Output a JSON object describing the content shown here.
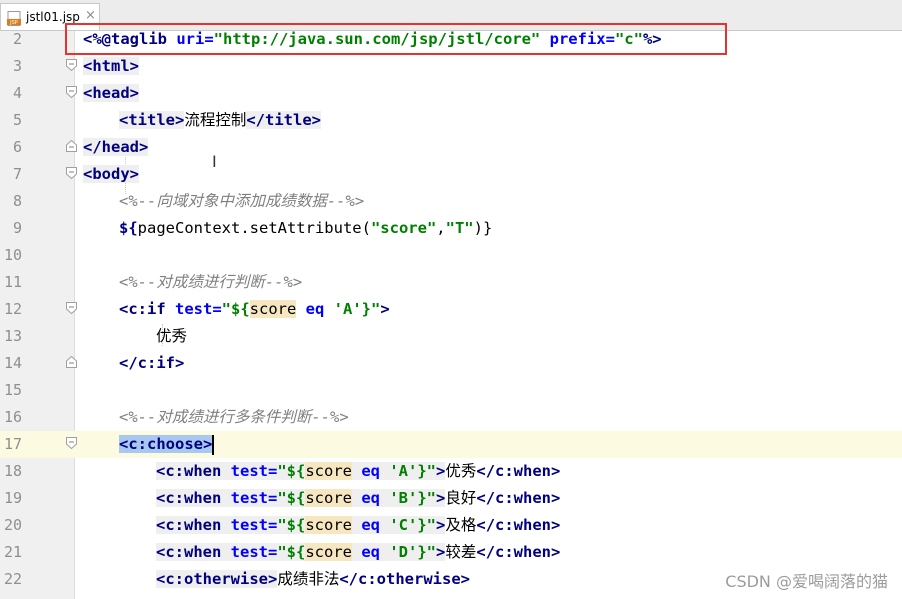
{
  "tab": {
    "filename": "jstl01.jsp",
    "icon_label": "JSP",
    "close": "×"
  },
  "lines": [
    {
      "n": "2"
    },
    {
      "n": "3"
    },
    {
      "n": "4"
    },
    {
      "n": "5"
    },
    {
      "n": "6"
    },
    {
      "n": "7"
    },
    {
      "n": "8"
    },
    {
      "n": "9"
    },
    {
      "n": "10"
    },
    {
      "n": "11"
    },
    {
      "n": "12"
    },
    {
      "n": "13"
    },
    {
      "n": "14"
    },
    {
      "n": "15"
    },
    {
      "n": "16"
    },
    {
      "n": "17"
    },
    {
      "n": "18"
    },
    {
      "n": "19"
    },
    {
      "n": "20"
    },
    {
      "n": "21"
    },
    {
      "n": "22"
    }
  ],
  "code": {
    "l2": {
      "open": "<%@taglib ",
      "a1": "uri=",
      "v1": "\"http://java.sun.com/jsp/jstl/core\"",
      "a2": " prefix=",
      "v2": "\"c\"",
      "close": "%>"
    },
    "l3": "<html>",
    "l4": "<head>",
    "l5": {
      "o": "<title>",
      "t": "流程控制",
      "c": "</title>"
    },
    "l6": "</head>",
    "l7": "<body>",
    "l8": "<%--向域对象中添加成绩数据--%>",
    "l9": {
      "a": "${",
      "b": "pageContext.setAttribute(",
      "c": "\"score\"",
      "d": ",",
      "e": "\"T\"",
      "f": ")}"
    },
    "l11": "<%--对成绩进行判断--%>",
    "l12": {
      "o": "<c:if ",
      "a": "test=",
      "q": "\"${",
      "s": "score",
      "e": " eq ",
      "v": "'A'",
      "qc": "}\"",
      "c": ">"
    },
    "l13": "优秀",
    "l14": "</c:if>",
    "l16": "<%--对成绩进行多条件判断--%>",
    "l17": "<c:choose>",
    "when": [
      {
        "v": "'A'",
        "t": "优秀"
      },
      {
        "v": "'B'",
        "t": "良好"
      },
      {
        "v": "'C'",
        "t": "及格"
      },
      {
        "v": "'D'",
        "t": "较差"
      }
    ],
    "when_parts": {
      "o": "<c:when ",
      "a": "test=",
      "q": "\"${",
      "s": "score",
      "e": " eq ",
      "qc": "}\"",
      "gt": ">",
      "c": "</c:when>"
    },
    "l22": {
      "o": "<c:otherwise>",
      "t": "成绩非法",
      "c": "</c:otherwise>"
    }
  },
  "watermark": "CSDN @爱喝阔落的猫",
  "colors": {
    "highlight_box": "#e8322f",
    "selection": "#a8c8f0",
    "current_line": "#fcfae1"
  }
}
